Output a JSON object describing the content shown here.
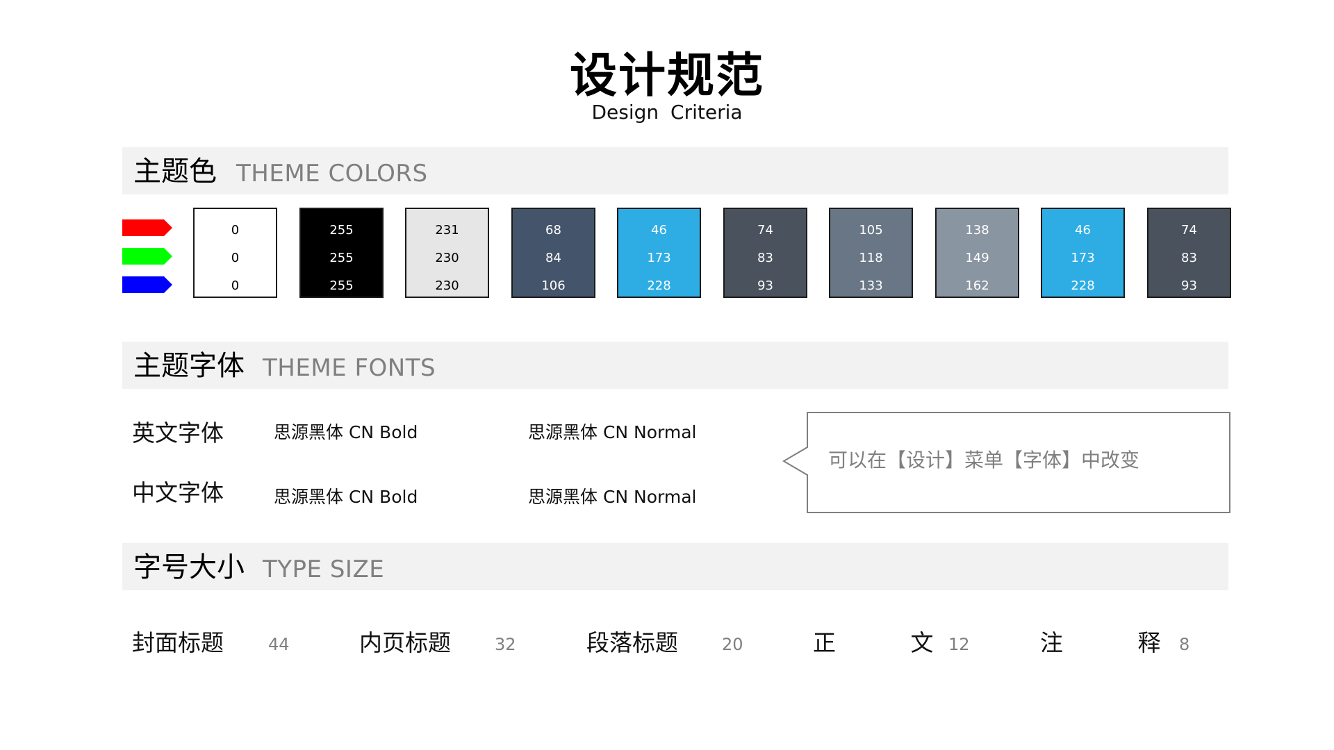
{
  "header": {
    "title": "设计规范",
    "subtitle": "Design  Criteria"
  },
  "sections": {
    "colors": {
      "zh": "主题色",
      "en": "THEME COLORS"
    },
    "fonts": {
      "zh": "主题字体",
      "en": "THEME FONTS"
    },
    "sizes": {
      "zh": "字号大小",
      "en": "TYPE SIZE"
    }
  },
  "rgb_arrows": [
    {
      "channel": "red",
      "color": "#ff0000"
    },
    {
      "channel": "green",
      "color": "#00ff00"
    },
    {
      "channel": "blue",
      "color": "#0000ff"
    }
  ],
  "swatches": [
    {
      "r": "0",
      "g": "0",
      "b": "0",
      "fill": "#ffffff",
      "text_color": "#000000"
    },
    {
      "r": "255",
      "g": "255",
      "b": "255",
      "fill": "#000000",
      "text_color": "#ffffff"
    },
    {
      "r": "231",
      "g": "230",
      "b": "230",
      "fill": "#e7e6e6",
      "text_color": "#000000"
    },
    {
      "r": "68",
      "g": "84",
      "b": "106",
      "fill": "#44546a",
      "text_color": "#ffffff"
    },
    {
      "r": "46",
      "g": "173",
      "b": "228",
      "fill": "#2eade4",
      "text_color": "#ffffff"
    },
    {
      "r": "74",
      "g": "83",
      "b": "93",
      "fill": "#4a535d",
      "text_color": "#ffffff"
    },
    {
      "r": "105",
      "g": "118",
      "b": "133",
      "fill": "#697685",
      "text_color": "#ffffff"
    },
    {
      "r": "138",
      "g": "149",
      "b": "162",
      "fill": "#8a95a2",
      "text_color": "#ffffff"
    },
    {
      "r": "46",
      "g": "173",
      "b": "228",
      "fill": "#2eade4",
      "text_color": "#ffffff"
    },
    {
      "r": "74",
      "g": "83",
      "b": "93",
      "fill": "#4a535d",
      "text_color": "#ffffff"
    }
  ],
  "fonts": {
    "english": {
      "label": "英文字体",
      "heading": "思源黑体 CN Bold",
      "body": "思源黑体 CN Normal"
    },
    "chinese": {
      "label": "中文字体",
      "heading": "思源黑体 CN Bold",
      "body": "思源黑体 CN Normal"
    },
    "callout": "可以在【设计】菜单【字体】中改变"
  },
  "type_sizes": [
    {
      "label": "封面标题",
      "size": "44"
    },
    {
      "label": "内页标题",
      "size": "32"
    },
    {
      "label": "段落标题",
      "size": "20"
    },
    {
      "label": "正　 文",
      "size": "12"
    },
    {
      "label": "注　 释",
      "size": "8"
    }
  ]
}
